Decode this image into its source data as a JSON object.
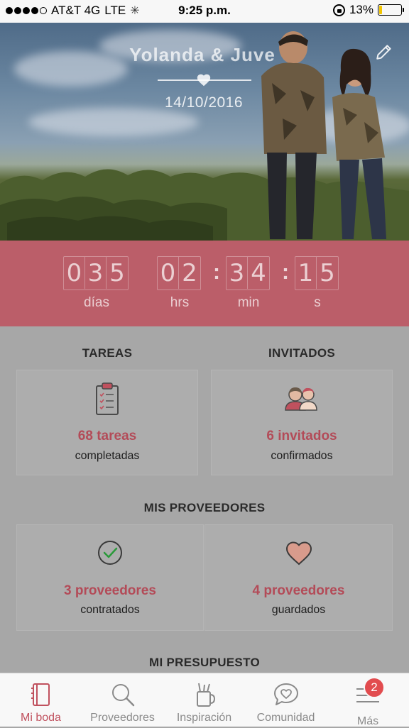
{
  "status_bar": {
    "carrier": "AT&T 4G",
    "network": "LTE",
    "time": "9:25 p.m.",
    "battery_percent": "13%",
    "battery_level": 0.13
  },
  "hero": {
    "couple_name": "Yolanda & Juve",
    "date": "14/10/2016"
  },
  "countdown": {
    "days": [
      "0",
      "3",
      "5"
    ],
    "hours": [
      "0",
      "2"
    ],
    "minutes": [
      "3",
      "4"
    ],
    "seconds": [
      "1",
      "5"
    ],
    "labels": {
      "days": "días",
      "hours": "hrs",
      "minutes": "min",
      "seconds": "s"
    }
  },
  "tareas": {
    "title": "TAREAS",
    "main": "68 tareas",
    "sub": "completadas"
  },
  "invitados": {
    "title": "INVITADOS",
    "main": "6 invitados",
    "sub": "confirmados"
  },
  "proveedores": {
    "title": "MIS PROVEEDORES",
    "contratados_main": "3 proveedores",
    "contratados_sub": "contratados",
    "guardados_main": "4 proveedores",
    "guardados_sub": "guardados"
  },
  "presupuesto": {
    "title": "MI PRESUPUESTO"
  },
  "tab_bar": {
    "items": [
      {
        "label": "Mi boda",
        "icon": "notebook-icon"
      },
      {
        "label": "Proveedores",
        "icon": "search-icon"
      },
      {
        "label": "Inspiración",
        "icon": "inspiration-icon"
      },
      {
        "label": "Comunidad",
        "icon": "community-heart-icon"
      },
      {
        "label": "Más",
        "icon": "menu-icon"
      }
    ],
    "badge": "2"
  },
  "colors": {
    "accent": "#bb5e69",
    "accent_text": "#b34b58",
    "badge": "#e24c4f"
  }
}
